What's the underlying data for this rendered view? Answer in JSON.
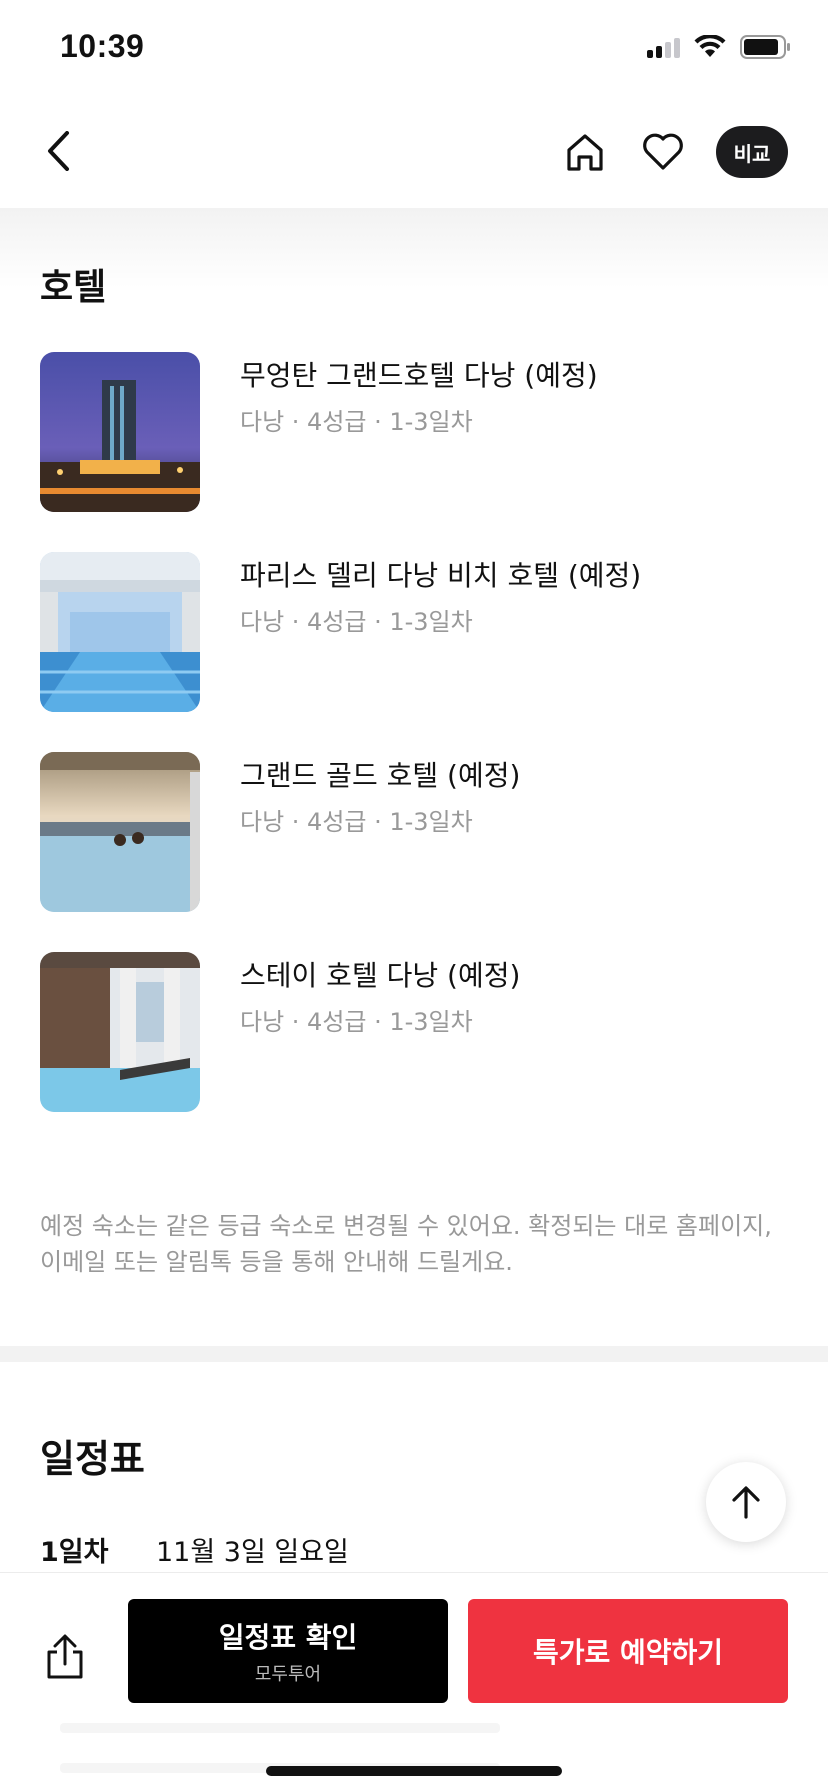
{
  "status_bar": {
    "time": "10:39"
  },
  "nav": {
    "compare_label": "비교"
  },
  "hotels_section": {
    "title": "호텔",
    "items": [
      {
        "name": "무엉탄 그랜드호텔 다낭 (예정)",
        "meta": "다낭 · 4성급 · 1-3일차"
      },
      {
        "name": "파리스 델리 다낭 비치 호텔 (예정)",
        "meta": "다낭 · 4성급 · 1-3일차"
      },
      {
        "name": "그랜드 골드 호텔 (예정)",
        "meta": "다낭 · 4성급 · 1-3일차"
      },
      {
        "name": "스테이 호텔 다낭 (예정)",
        "meta": "다낭 · 4성급 · 1-3일차"
      }
    ],
    "notice": "예정 숙소는 같은 등급 숙소로 변경될 수 있어요. 확정되는 대로 홈페이지, 이메일 또는 알림톡 등을 통해 안내해 드릴게요."
  },
  "schedule_section": {
    "title": "일정표",
    "first_day": {
      "day": "1일차",
      "date": "11월 3일 일요일"
    }
  },
  "bottom_bar": {
    "schedule_button": {
      "label": "일정표 확인",
      "sub": "모두투어"
    },
    "book_button": {
      "label": "특가로 예약하기"
    }
  },
  "colors": {
    "accent_red": "#ef3340",
    "dark_button": "#000000",
    "compare_pill": "#1c1c1e"
  }
}
